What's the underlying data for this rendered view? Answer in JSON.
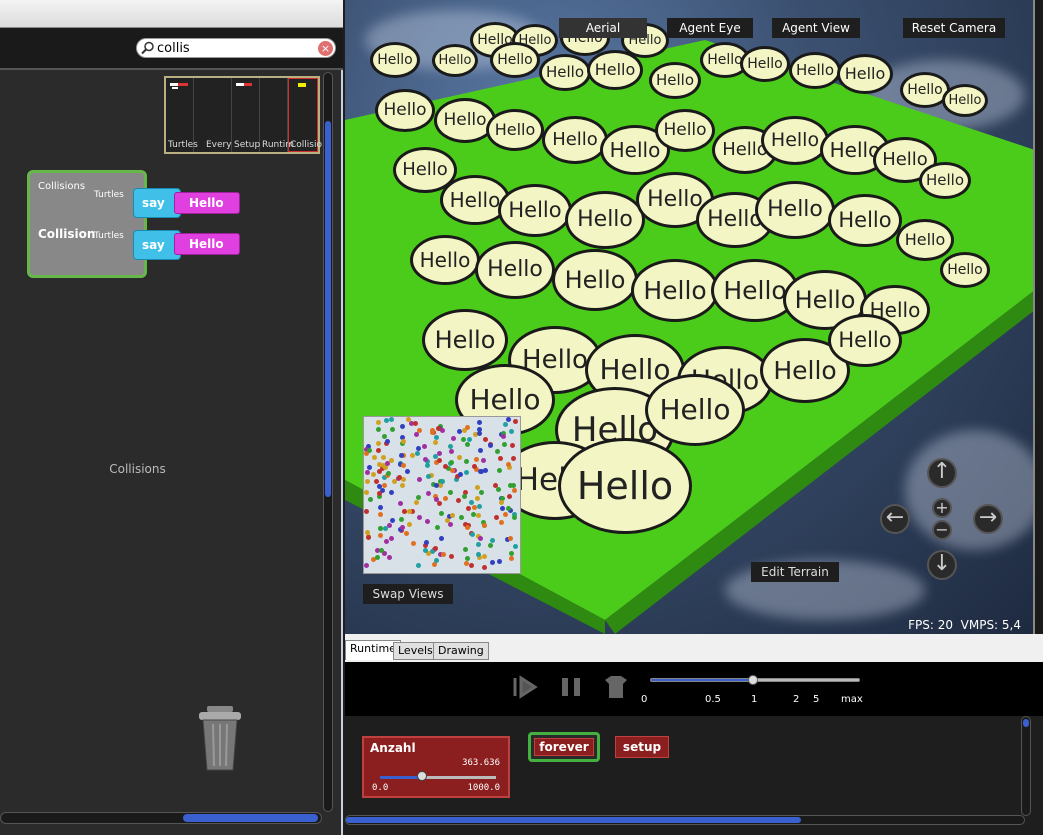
{
  "search": {
    "value": "collis",
    "clear_icon": "clear-icon",
    "search_icon": "search-icon"
  },
  "drawers": [
    {
      "label": "Turtles"
    },
    {
      "label": "Every"
    },
    {
      "label": "Setup"
    },
    {
      "label": "Runtim"
    },
    {
      "label": "Collisio"
    }
  ],
  "collision_block": {
    "label_top": "Collisions",
    "label_top_sub": "Turtles",
    "label_bottom": "Collision",
    "label_bottom_sub": "Turtles",
    "say_label": "say",
    "hello_label": "Hello"
  },
  "page_label": "Collisions",
  "view_buttons": [
    {
      "label": "Aerial"
    },
    {
      "label": "Agent Eye"
    },
    {
      "label": "Agent View"
    },
    {
      "label": "Reset Camera"
    }
  ],
  "bubble_text": "Hello",
  "swap_views_label": "Swap Views",
  "edit_terrain_label": "Edit Terrain",
  "status": {
    "fps_text": "FPS: 20",
    "vmps_text": "VMPS: 5,4"
  },
  "tabs": [
    {
      "label": "Runtime",
      "active": true
    },
    {
      "label": "Levels"
    },
    {
      "label": "Drawing"
    }
  ],
  "speed_ticks": [
    "0",
    "0.5",
    "1",
    "2",
    "5",
    "max"
  ],
  "speed_level": 1,
  "anzahl": {
    "title": "Anzahl",
    "value": "363.636",
    "min": "0.0",
    "max": "1000.0"
  },
  "forever_label": "forever",
  "setup_label": "setup"
}
